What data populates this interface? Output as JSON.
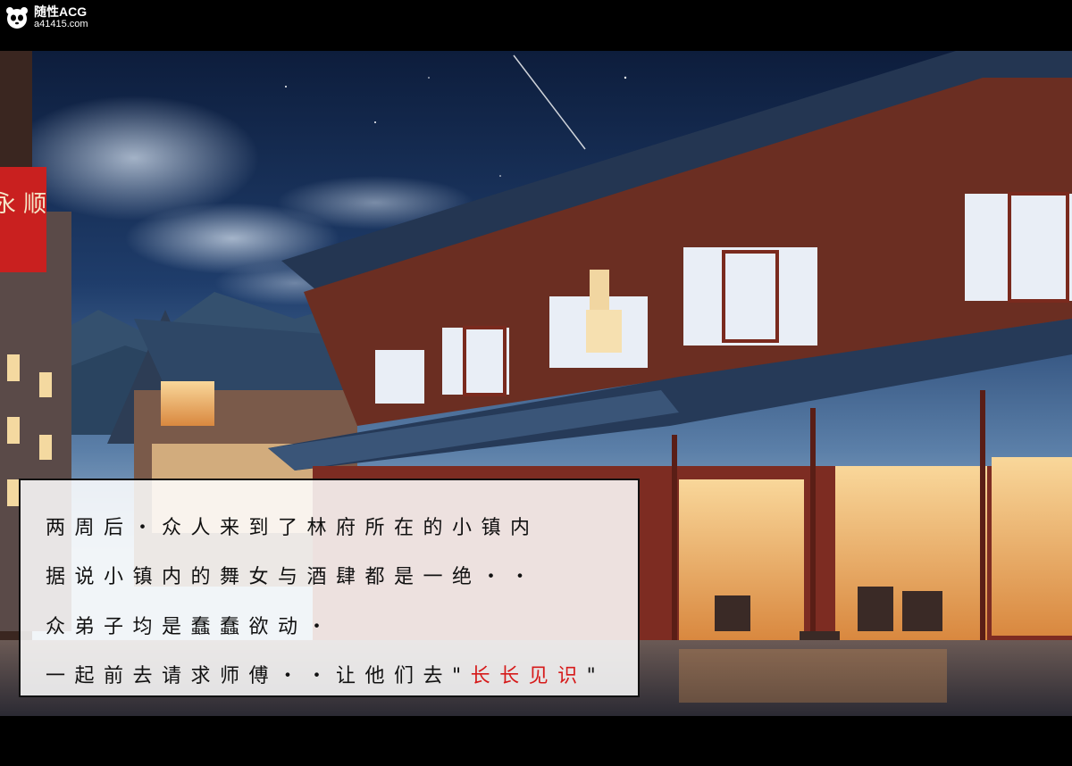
{
  "watermark": {
    "name": "随性ACG",
    "url": "a41415.com",
    "icon": "panda-logo-icon"
  },
  "scene": {
    "description_icon": "night-chinese-town-illustration",
    "sign_text": "永 顺"
  },
  "dialogue": {
    "line1": "两周后・众人来到了林府所在的小镇内",
    "line2": "据说小镇内的舞女与酒肆都是一绝・・",
    "line3": "众弟子均是蠢蠢欲动・",
    "line4_prefix": "一起前去请求师傅・・让他们去\"",
    "line4_highlight": "长长见识",
    "line4_suffix": "\"",
    "highlight_color": "#d61a1a"
  }
}
